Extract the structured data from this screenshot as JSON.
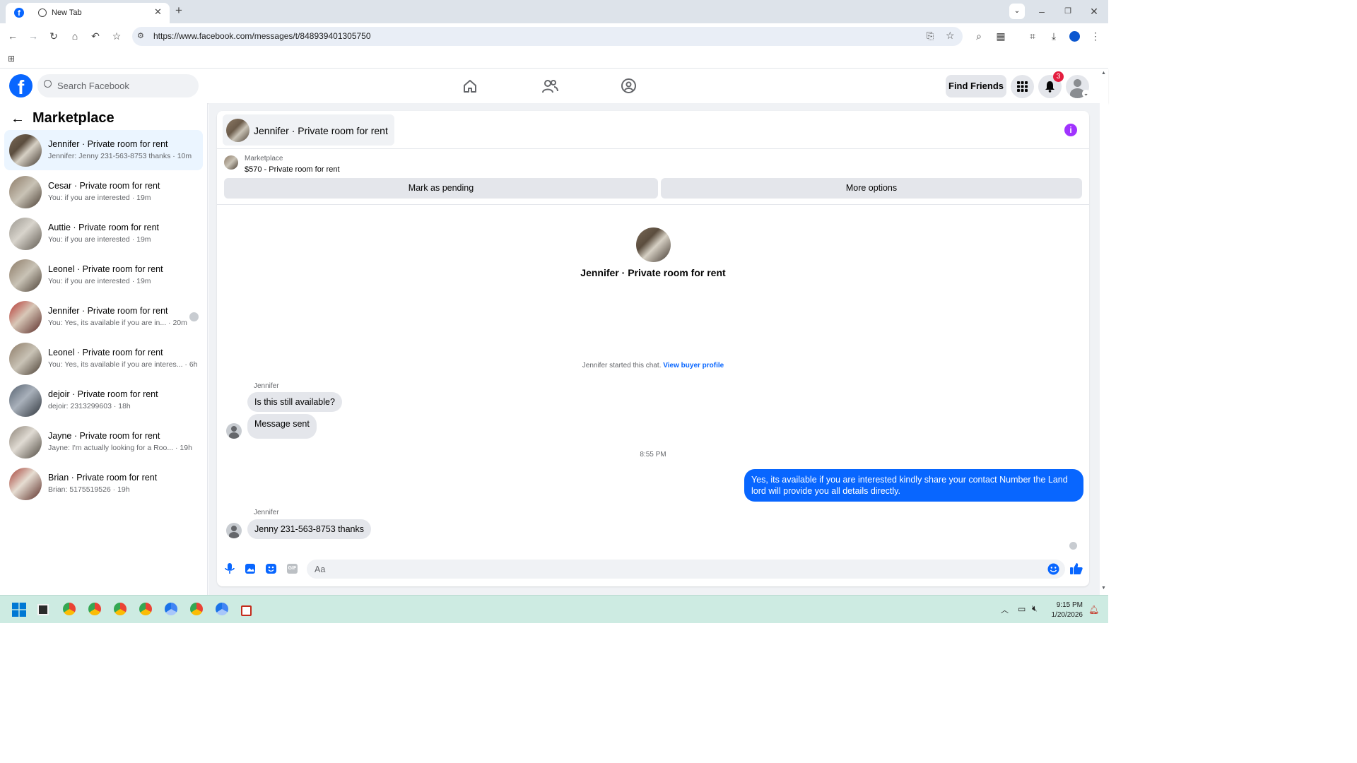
{
  "browser": {
    "tabs": [
      {
        "label": "",
        "icon": "facebook-icon",
        "active": true
      },
      {
        "label": "New Tab",
        "icon": "globe-icon",
        "active": false
      }
    ],
    "url": "https://www.facebook.com/messages/t/848939401305750"
  },
  "fb_nav": {
    "search_placeholder": "Search Facebook",
    "find_friends_label": "Find Friends",
    "notification_count": "3"
  },
  "sidebar": {
    "title": "Marketplace",
    "conversations": [
      {
        "title": "Jennifer · Private room for rent",
        "subtitle": "Jennifer: Jenny 231-563-8753 thanks · 10m",
        "active": true
      },
      {
        "title": "Cesar · Private room for rent",
        "subtitle": "You: if you are interested · 19m"
      },
      {
        "title": "Auttie · Private room for rent",
        "subtitle": "You: if you are interested · 19m"
      },
      {
        "title": "Leonel · Private room for rent",
        "subtitle": "You: if you are interested · 19m"
      },
      {
        "title": "Jennifer · Private room for rent",
        "subtitle": "You: Yes, its available if you are in...  · 20m"
      },
      {
        "title": "Leonel · Private room for rent",
        "subtitle": "You: Yes, its available if you are interes... · 6h"
      },
      {
        "title": "dejoir · Private room for rent",
        "subtitle": "dejoir: 2313299603 · 18h"
      },
      {
        "title": "Jayne · Private room for rent",
        "subtitle": "Jayne: I'm actually looking for a Roo... · 19h"
      },
      {
        "title": "Brian · Private room for rent",
        "subtitle": "Brian: 5175519526 · 19h"
      }
    ]
  },
  "chat": {
    "header_title": "Jennifer · Private room for rent",
    "listing_source": "Marketplace",
    "listing_title": "$570 - Private room for rent",
    "mark_pending_label": "Mark as pending",
    "more_options_label": "More options",
    "intro_title": "Jennifer · Private room for rent",
    "started_text": "Jennifer started this chat.",
    "view_profile_label": "View buyer profile",
    "messages": [
      {
        "sender": "Jennifer",
        "text": "Is this still available?"
      },
      {
        "text": "Message sent"
      }
    ],
    "timestamp": "8:55 PM",
    "my_message": "Yes, its available if you are interested kindly share your contact Number the Land lord will provide you all details directly.",
    "reply_sender": "Jennifer",
    "reply_text": "Jenny 231-563-8753 thanks",
    "composer_placeholder": "Aa"
  },
  "taskbar": {
    "time": "9:15 PM",
    "date": "1/20/2026"
  },
  "colors": {
    "fb_blue": "#0866ff",
    "info_purple": "#a033ff",
    "taskbar": "#cdebe2"
  }
}
